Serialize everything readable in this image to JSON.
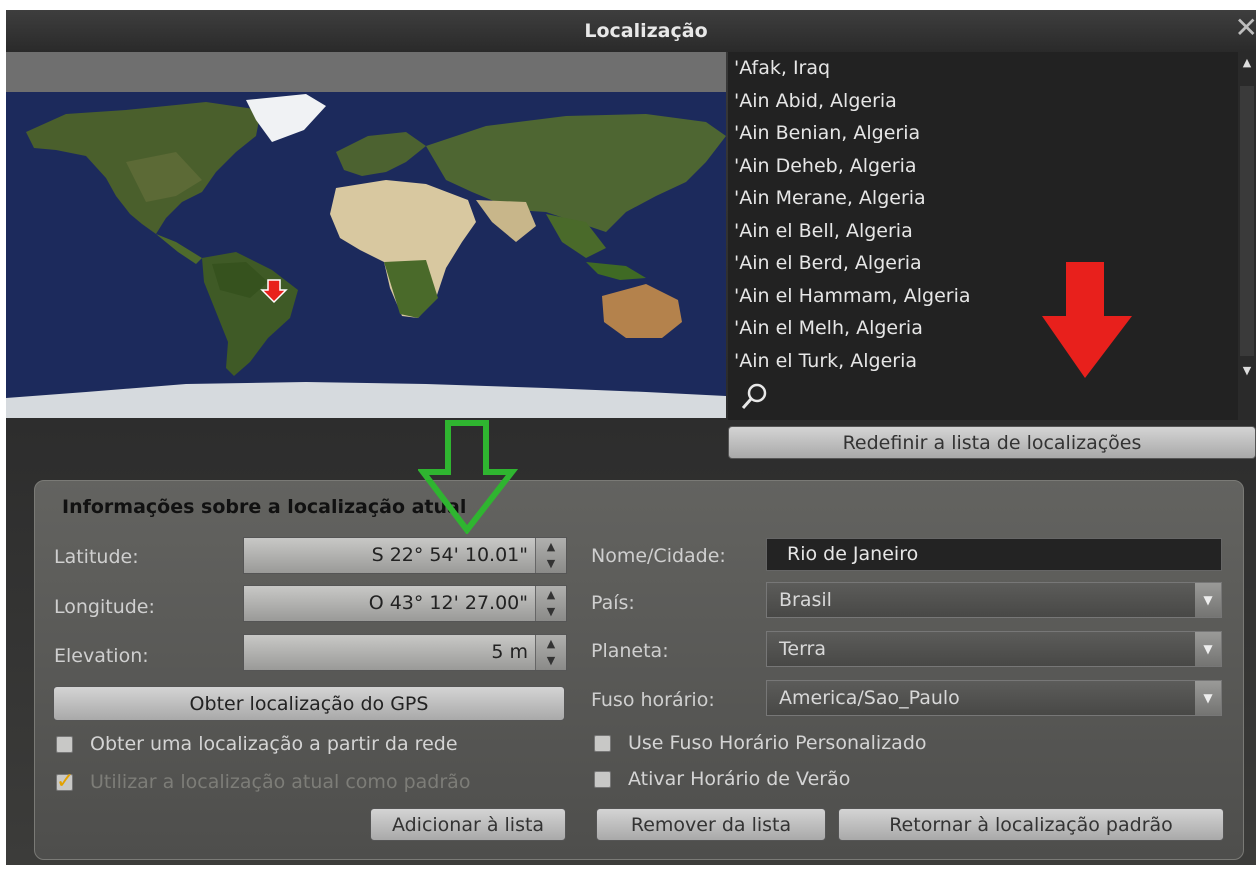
{
  "window": {
    "title": "Localização",
    "close_icon": "close-icon"
  },
  "city_list": {
    "items": [
      "'Afak, Iraq",
      "'Ain Abid, Algeria",
      "'Ain Benian, Algeria",
      "'Ain Deheb, Algeria",
      "'Ain Merane, Algeria",
      "'Ain el Bell, Algeria",
      "'Ain el Berd, Algeria",
      "'Ain el Hammam, Algeria",
      "'Ain el Melh, Algeria",
      "'Ain el Turk, Algeria"
    ],
    "search_icon": "search-icon"
  },
  "reset_button": "Redefinir a lista de localizações",
  "info": {
    "title": "Informações sobre a localização atual",
    "latitude_label": "Latitude:",
    "latitude_value": "S 22° 54' 10.01\"",
    "longitude_label": "Longitude:",
    "longitude_value": "O 43° 12' 27.00\"",
    "elevation_label": "Elevation:",
    "elevation_value": "5 m",
    "gps_button": "Obter localização do GPS",
    "network_checkbox": {
      "label": "Obter uma localização a partir da rede",
      "checked": false
    },
    "default_checkbox": {
      "label": "Utilizar a localização atual como padrão",
      "checked": true
    },
    "name_label": "Nome/Cidade:",
    "name_value": "Rio de Janeiro",
    "country_label": "País:",
    "country_value": "Brasil",
    "planet_label": "Planeta:",
    "planet_value": "Terra",
    "timezone_label": "Fuso horário:",
    "timezone_value": "America/Sao_Paulo",
    "custom_tz_checkbox": {
      "label": "Use Fuso Horário Personalizado",
      "checked": false
    },
    "dst_checkbox": {
      "label": "Ativar Horário de Verão",
      "checked": false
    }
  },
  "buttons": {
    "add": "Adicionar à lista",
    "remove": "Remover da lista",
    "restore": "Retornar à localização padrão"
  },
  "colors": {
    "accent_red": "#e8201c",
    "accent_green": "#2fb530",
    "check_yellow": "#e2a100"
  }
}
